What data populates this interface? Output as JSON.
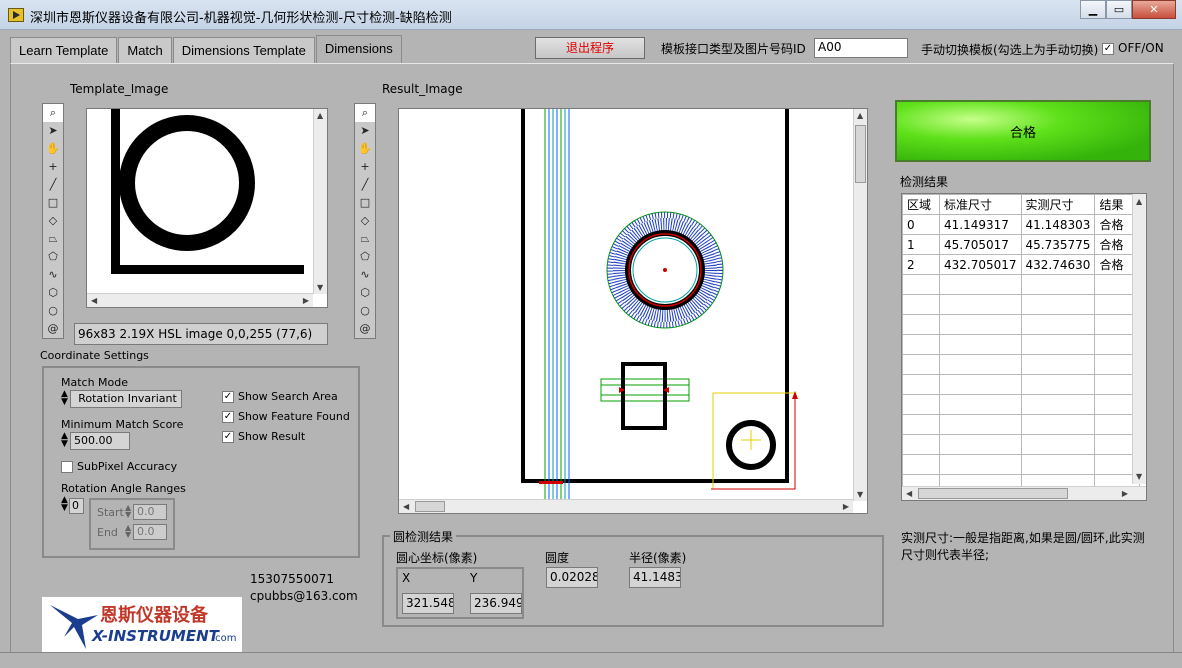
{
  "window": {
    "title": "深圳市恩斯仪器设备有限公司-机器视觉-几何形状检测-尺寸检测-缺陷检测"
  },
  "tabs": [
    {
      "label": "Learn Template"
    },
    {
      "label": "Match"
    },
    {
      "label": "Dimensions Template"
    },
    {
      "label": "Dimensions"
    }
  ],
  "header": {
    "exit_label": "退出程序",
    "template_id_label": "模板接口类型及图片号码ID",
    "template_id_value": "A00",
    "manual_switch_label": "手动切换模板(勾选上为手动切换)",
    "manual_switch_checked": true,
    "offon_label": "OFF/ON"
  },
  "template": {
    "title": "Template_Image",
    "info": "96x83 2.19X HSL image 0,0,255    (77,6)"
  },
  "result": {
    "title": "Result_Image"
  },
  "coord_settings": {
    "title": "Coordinate Settings",
    "match_mode_label": "Match Mode",
    "match_mode_value": "Rotation Invariant",
    "min_score_label": "Minimum Match Score",
    "min_score_value": "500.00",
    "subpixel_label": "SubPixel Accuracy",
    "subpixel_checked": false,
    "angle_label": "Rotation Angle Ranges",
    "angle_index": "0",
    "start_label": "Start",
    "start_value": "0.0",
    "end_label": "End",
    "end_value": "0.0",
    "show_search_label": "Show Search Area",
    "show_feature_label": "Show Feature Found",
    "show_result_label": "Show Result"
  },
  "contact": {
    "phone": "15307550071",
    "email": "cpubbs@163.com",
    "logo_cn": "恩斯仪器设备",
    "logo_en": "X-INSTRUMENT",
    "logo_com": ".com"
  },
  "circle_result": {
    "title": "圆检测结果",
    "center_label": "圆心坐标(像素)",
    "x_label": "X",
    "y_label": "Y",
    "x_value": "321.548",
    "y_value": "236.949",
    "roundness_label": "圆度",
    "roundness_value": "0.02028",
    "radius_label": "半径(像素)",
    "radius_value": "41.1483"
  },
  "pass_label": "合格",
  "results": {
    "title": "检测结果",
    "headers": [
      "区域",
      "标准尺寸",
      "实测尺寸",
      "结果"
    ],
    "rows": [
      [
        "0",
        "41.149317",
        "41.148303",
        "合格"
      ],
      [
        "1",
        "45.705017",
        "45.735775",
        "合格"
      ],
      [
        "2",
        "432.705017",
        "432.74630",
        "合格"
      ]
    ],
    "note": "实测尺寸:一般是指距离,如果是圆/圆环,此实测尺寸则代表半径;"
  },
  "icons": [
    "zoom-icon",
    "pointer-icon",
    "pan-icon",
    "crosshair-icon",
    "line-icon",
    "rectangle-icon",
    "diamond-icon",
    "rotated-rect-icon",
    "polygon-icon",
    "freehand-icon",
    "annulus-icon",
    "circle-icon",
    "spiral-icon"
  ]
}
